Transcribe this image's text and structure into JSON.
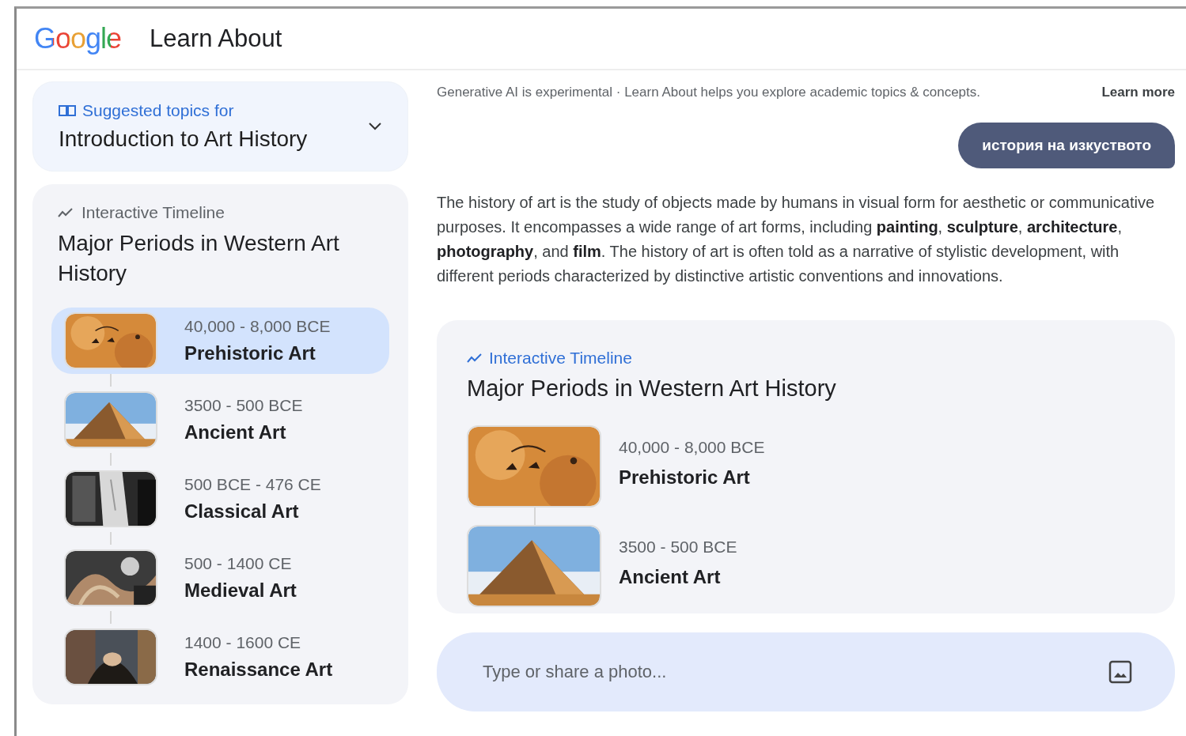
{
  "header": {
    "logo": "Google",
    "title": "Learn About"
  },
  "suggested": {
    "label": "Suggested topics for",
    "topic": "Introduction to Art History",
    "expanded": false
  },
  "sidebar_timeline": {
    "label": "Interactive Timeline",
    "title": "Major Periods in Western Art History",
    "items": [
      {
        "dates": "40,000 - 8,000 BCE",
        "name": "Prehistoric Art",
        "selected": true
      },
      {
        "dates": "3500 - 500 BCE",
        "name": "Ancient Art",
        "selected": false
      },
      {
        "dates": "500 BCE - 476 CE",
        "name": "Classical Art",
        "selected": false
      },
      {
        "dates": "500 - 1400 CE",
        "name": "Medieval Art",
        "selected": false
      },
      {
        "dates": "1400 - 1600 CE",
        "name": "Renaissance Art",
        "selected": false
      }
    ]
  },
  "notice": {
    "text": "Generative AI is experimental · Learn About helps you explore academic topics & concepts.",
    "link": "Learn more"
  },
  "query": "история на изкуството",
  "answer": "The history of art is the study of objects made by humans in visual form for aesthetic or communicative purposes. It encompasses a wide range of art forms, including **painting**, **sculpture**, **architecture**, **photography**, and **film**. The history of art is often told as a narrative of stylistic development, with different periods characterized by distinctive artistic conventions and innovations.",
  "timeline_card": {
    "label": "Interactive Timeline",
    "title": "Major Periods in Western Art History",
    "items": [
      {
        "dates": "40,000 - 8,000 BCE",
        "name": "Prehistoric Art"
      },
      {
        "dates": "3500 - 500 BCE",
        "name": "Ancient Art"
      }
    ]
  },
  "input": {
    "placeholder": "Type or share a photo..."
  }
}
